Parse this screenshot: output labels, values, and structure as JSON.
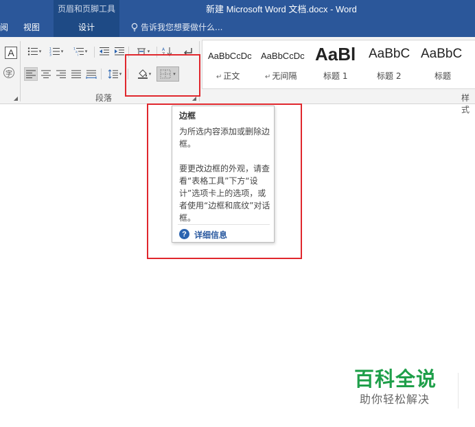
{
  "window": {
    "context_group_label": "页眉和页脚工具",
    "title": "新建 Microsoft Word 文档.docx - Word"
  },
  "tabs": {
    "review_partial": "阅",
    "view": "视图",
    "design": "设计",
    "tell_me": "告诉我您想要做什么..."
  },
  "ribbon": {
    "font_box_letter": "A",
    "enclose_char": "字",
    "paragraph_group_label": "段落",
    "styles_group_label": "样式",
    "styles": [
      {
        "sample": "AaBbCcDc",
        "name": "正文",
        "mark": "↵"
      },
      {
        "sample": "AaBbCcDc",
        "name": "无间隔",
        "mark": "↵"
      },
      {
        "sample": "AaBl",
        "name": "标题 1",
        "mark": ""
      },
      {
        "sample": "AaBbC",
        "name": "标题 2",
        "mark": ""
      },
      {
        "sample": "AaBbC",
        "name": "标题",
        "mark": ""
      }
    ]
  },
  "tooltip": {
    "title": "边框",
    "desc1": "为所选内容添加或删除边框。",
    "desc2": "要更改边框的外观，请查看“表格工具”下方“设计”选项卡上的选项，或者使用“边框和底纹”对话框。",
    "more_info": "详细信息",
    "help_glyph": "?"
  },
  "watermark": {
    "title": "百科全说",
    "subtitle": "助你轻松解决"
  },
  "colors": {
    "ribbon_blue": "#2b579a",
    "highlight_red": "#e0262c",
    "watermark_green": "#1f9f4a"
  }
}
